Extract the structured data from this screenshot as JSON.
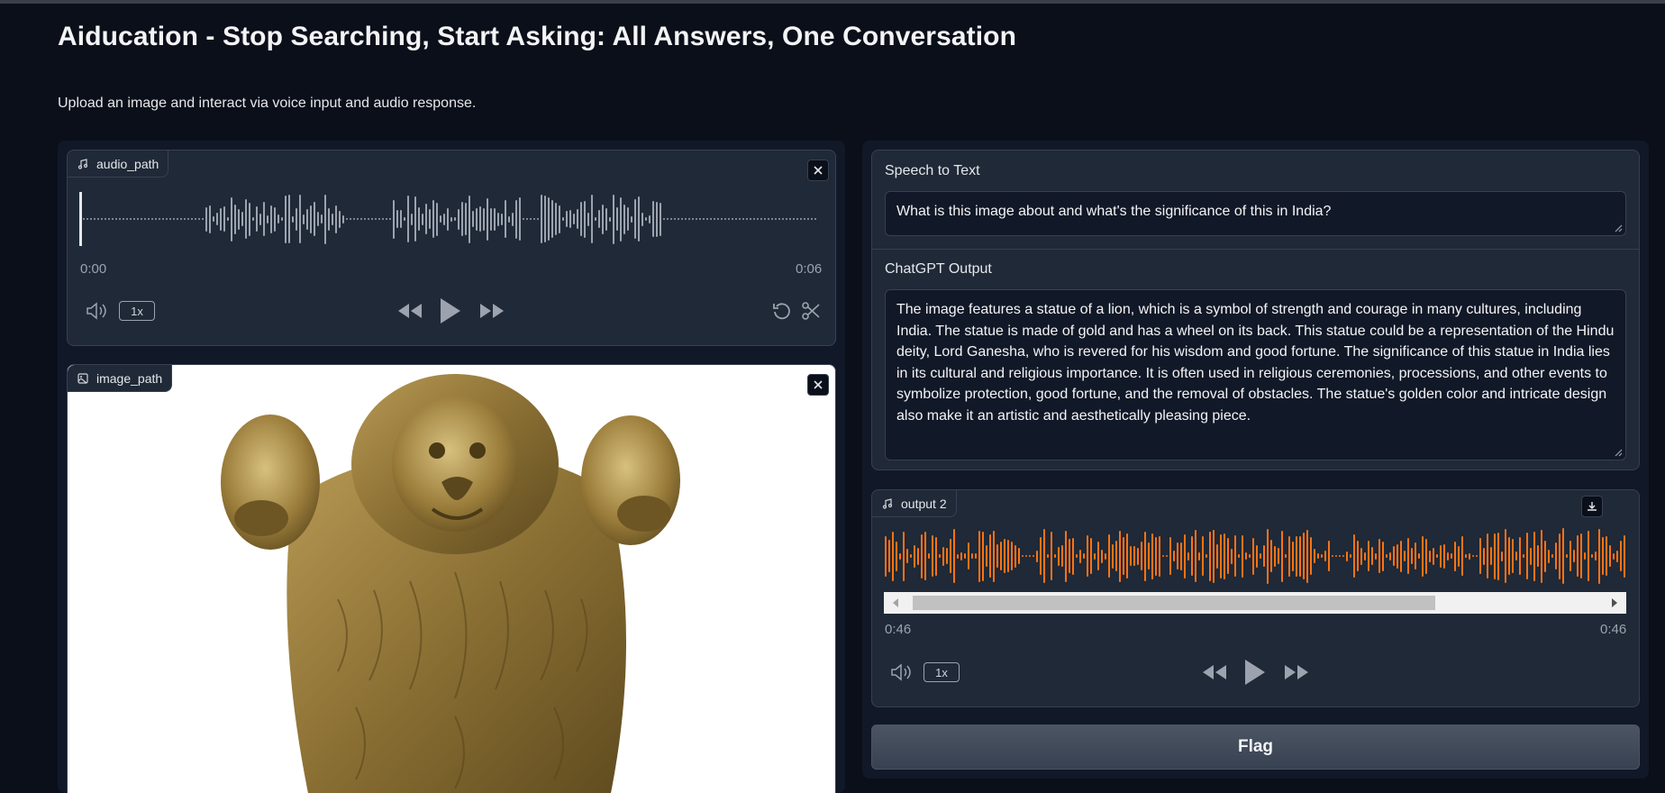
{
  "header": {
    "title": "Aiducation - Stop Searching, Start Asking: All Answers, One Conversation",
    "description": "Upload an image and interact via voice input and audio response."
  },
  "audio_input": {
    "label": "audio_path",
    "current_time": "0:00",
    "duration": "0:06",
    "playback_rate": "1x",
    "waveform_color": "#9ca3af",
    "icons": [
      "music-note-icon",
      "close-icon",
      "volume-icon",
      "rewind-icon",
      "play-icon",
      "fast-forward-icon",
      "reset-icon",
      "trim-scissors-icon"
    ]
  },
  "image_input": {
    "label": "image_path",
    "image_subject": "brass lion capital statue",
    "icons": [
      "image-icon",
      "close-icon"
    ]
  },
  "speech_to_text": {
    "label": "Speech to Text",
    "value": "What is this image about and what's the significance of this in India?"
  },
  "chatgpt_output": {
    "label": "ChatGPT Output",
    "value": "The image features a statue of a lion, which is a symbol of strength and courage in many cultures, including India. The statue is made of gold and has a wheel on its back. This statue could be a representation of the Hindu deity, Lord Ganesha, who is revered for his wisdom and good fortune. The significance of this statue in India lies in its cultural and religious importance. It is often used in religious ceremonies, processions, and other events to symbolize protection, good fortune, and the removal of obstacles. The statue's golden color and intricate design also make it an artistic and aesthetically pleasing piece."
  },
  "audio_output": {
    "label": "output 2",
    "current_time": "0:46",
    "duration": "0:46",
    "playback_rate": "1x",
    "waveform_color": "#f97316",
    "scroll_position": 0.03,
    "icons": [
      "music-note-icon",
      "download-icon",
      "volume-icon",
      "rewind-icon",
      "play-icon",
      "fast-forward-icon"
    ]
  },
  "flag_button": {
    "label": "Flag"
  },
  "colors": {
    "background": "#0b0f19",
    "panel": "#111827",
    "block": "#1f2937",
    "border": "#374151",
    "accent_waveform": "#f97316"
  }
}
